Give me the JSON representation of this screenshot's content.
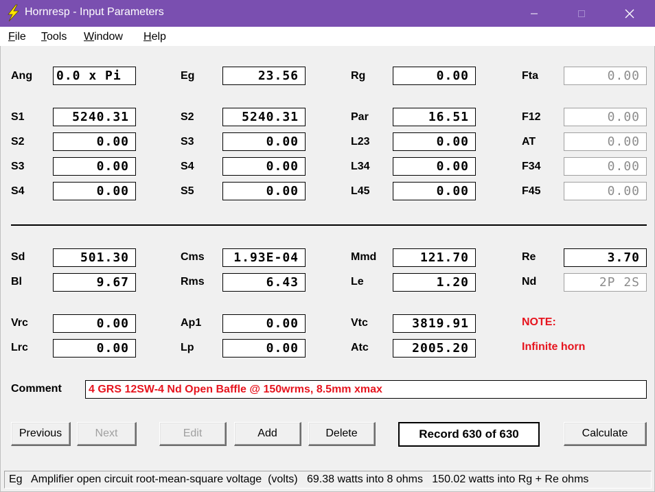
{
  "window": {
    "title": "Hornresp - Input Parameters"
  },
  "menu": [
    {
      "label": "File",
      "ul": "F",
      "rest": "ile"
    },
    {
      "label": "Tools",
      "ul": "T",
      "rest": "ools"
    },
    {
      "label": "Window",
      "ul": "W",
      "rest": "indow"
    },
    {
      "label": "Help",
      "ul": "H",
      "rest": "elp"
    }
  ],
  "params": {
    "ang": {
      "label": "Ang",
      "value": "0.0 x Pi"
    },
    "eg": {
      "label": "Eg",
      "value": "23.56"
    },
    "rg": {
      "label": "Rg",
      "value": "0.00"
    },
    "fta": {
      "label": "Fta",
      "value": "0.00"
    },
    "s1": {
      "label": "S1",
      "value": "5240.31"
    },
    "s2_top": {
      "label": "S2",
      "value": "5240.31"
    },
    "par": {
      "label": "Par",
      "value": "16.51"
    },
    "f12": {
      "label": "F12",
      "value": "0.00"
    },
    "s2": {
      "label": "S2",
      "value": "0.00"
    },
    "s3_mid": {
      "label": "S3",
      "value": "0.00"
    },
    "l23": {
      "label": "L23",
      "value": "0.00"
    },
    "at": {
      "label": "AT",
      "value": "0.00"
    },
    "s3": {
      "label": "S3",
      "value": "0.00"
    },
    "s4_mid": {
      "label": "S4",
      "value": "0.00"
    },
    "l34": {
      "label": "L34",
      "value": "0.00"
    },
    "f34": {
      "label": "F34",
      "value": "0.00"
    },
    "s4": {
      "label": "S4",
      "value": "0.00"
    },
    "s5": {
      "label": "S5",
      "value": "0.00"
    },
    "l45": {
      "label": "L45",
      "value": "0.00"
    },
    "f45": {
      "label": "F45",
      "value": "0.00"
    },
    "sd": {
      "label": "Sd",
      "value": "501.30"
    },
    "cms": {
      "label": "Cms",
      "value": "1.93E-04"
    },
    "mmd": {
      "label": "Mmd",
      "value": "121.70"
    },
    "re": {
      "label": "Re",
      "value": "3.70"
    },
    "bl": {
      "label": "Bl",
      "value": "9.67"
    },
    "rms": {
      "label": "Rms",
      "value": "6.43"
    },
    "le": {
      "label": "Le",
      "value": "1.20"
    },
    "nd": {
      "label": "Nd",
      "value": "2P 2S"
    },
    "vrc": {
      "label": "Vrc",
      "value": "0.00"
    },
    "ap1": {
      "label": "Ap1",
      "value": "0.00"
    },
    "vtc": {
      "label": "Vtc",
      "value": "3819.91"
    },
    "lrc": {
      "label": "Lrc",
      "value": "0.00"
    },
    "lp": {
      "label": "Lp",
      "value": "0.00"
    },
    "atc": {
      "label": "Atc",
      "value": "2005.20"
    }
  },
  "note": {
    "title": "NOTE:",
    "text": "Infinite horn"
  },
  "comment": {
    "label": "Comment",
    "value": "4 GRS 12SW-4 Nd Open Baffle @ 150wrms, 8.5mm xmax"
  },
  "buttons": {
    "previous": "Previous",
    "next": "Next",
    "edit": "Edit",
    "add": "Add",
    "delete": "Delete",
    "calculate": "Calculate"
  },
  "record": "Record 630 of 630",
  "status": "Eg   Amplifier open circuit root-mean-square voltage  (volts)   69.38 watts into 8 ohms   150.02 watts into Rg + Re ohms",
  "colors": {
    "titlebar": "#7a4fb0",
    "note": "#e6141e",
    "panel": "#f0f0f0"
  }
}
